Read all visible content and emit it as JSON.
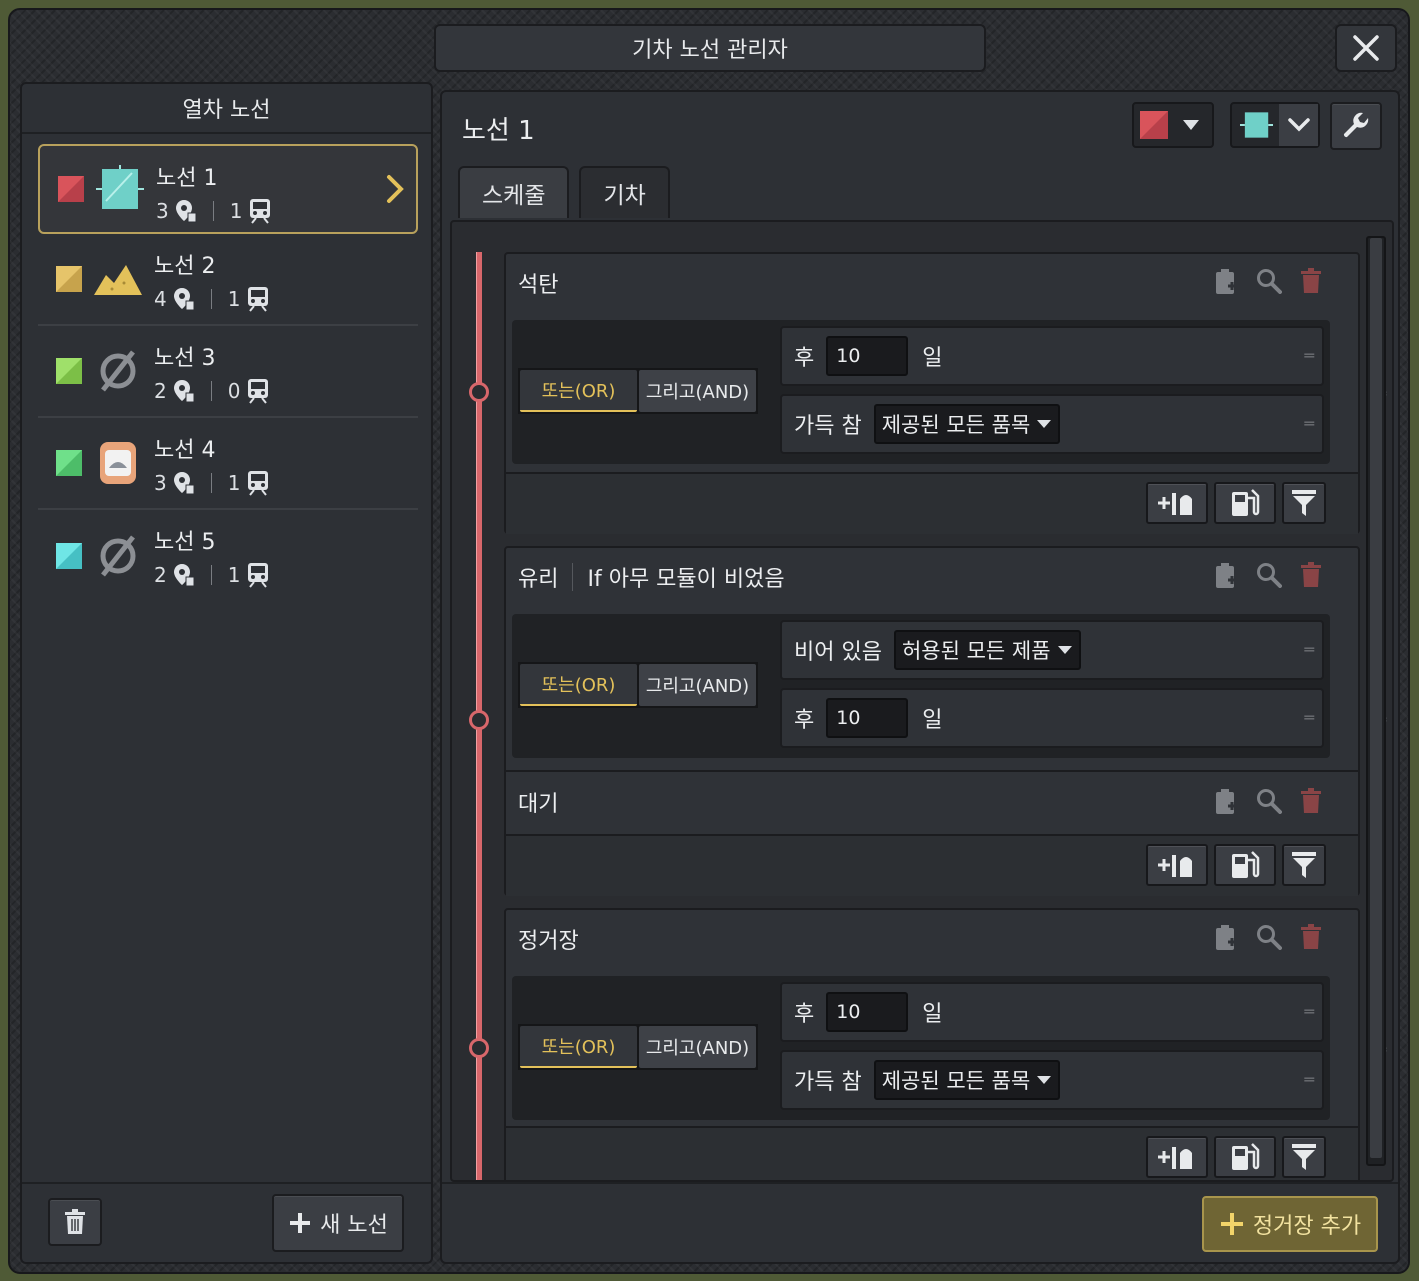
{
  "window": {
    "title": "기차 노선 관리자"
  },
  "left": {
    "header": "열차 노선",
    "routes": [
      {
        "name": "노선 1",
        "stops": "3",
        "trains": "1",
        "swatch": "#d9545b",
        "icon": "glass-icon",
        "selected": true
      },
      {
        "name": "노선 2",
        "stops": "4",
        "trains": "1",
        "swatch": "#d9b35a",
        "icon": "sand-icon",
        "selected": false
      },
      {
        "name": "노선 3",
        "stops": "2",
        "trains": "0",
        "swatch": "#8fd357",
        "icon": "empty-set-icon",
        "selected": false
      },
      {
        "name": "노선 4",
        "stops": "3",
        "trains": "1",
        "swatch": "#58d47a",
        "icon": "sack-icon",
        "selected": false
      },
      {
        "name": "노선 5",
        "stops": "2",
        "trains": "1",
        "swatch": "#5fd6d6",
        "icon": "empty-set-icon",
        "selected": false
      }
    ],
    "new_route_label": "새 노선"
  },
  "right": {
    "route_title": "노선 1",
    "tabs": [
      "스케줄",
      "기차"
    ],
    "stops": [
      {
        "name": "석탄",
        "subtitle": "",
        "logic": {
          "or": "또는(OR)",
          "and": "그리고(AND)"
        },
        "conditions": [
          {
            "prefix": "후",
            "value": "10",
            "suffix": "일"
          },
          {
            "prefix": "가득 참",
            "select": "제공된 모든 품목"
          }
        ]
      },
      {
        "name": "유리",
        "subtitle": "If 아무 모듈이 비었음",
        "logic": {
          "or": "또는(OR)",
          "and": "그리고(AND)"
        },
        "conditions": [
          {
            "prefix": "비어 있음",
            "select": "허용된 모든 제품"
          },
          {
            "prefix": "후",
            "value": "10",
            "suffix": "일"
          }
        ]
      },
      {
        "name": "대기"
      },
      {
        "name": "정거장",
        "logic": {
          "or": "또는(OR)",
          "and": "그리고(AND)"
        },
        "conditions": [
          {
            "prefix": "후",
            "value": "10",
            "suffix": "일"
          },
          {
            "prefix": "가득 참",
            "select": "제공된 모든 품목"
          }
        ]
      }
    ],
    "add_stop_label": "정거장 추가"
  },
  "colors": {
    "accent_gold": "#e3c15a",
    "timeline_red": "#d8676b",
    "route1_red": "#d9545b",
    "route1_cyan": "#6fd0c8"
  }
}
